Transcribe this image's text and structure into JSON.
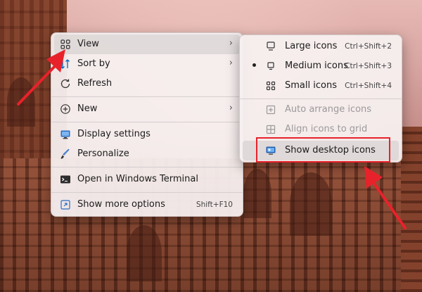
{
  "context_menu": {
    "items": [
      {
        "label": "View",
        "icon": "grid-icon",
        "has_submenu": true
      },
      {
        "label": "Sort by",
        "icon": "sort-icon",
        "has_submenu": true
      },
      {
        "label": "Refresh",
        "icon": "refresh-icon"
      },
      {
        "label": "New",
        "icon": "plus-circle-icon",
        "has_submenu": true
      },
      {
        "label": "Display settings",
        "icon": "display-icon"
      },
      {
        "label": "Personalize",
        "icon": "brush-icon"
      },
      {
        "label": "Open in Windows Terminal",
        "icon": "terminal-icon"
      },
      {
        "label": "Show more options",
        "icon": "more-options-icon",
        "shortcut": "Shift+F10"
      }
    ]
  },
  "view_submenu": {
    "items": [
      {
        "label": "Large icons",
        "shortcut": "Ctrl+Shift+2",
        "icon": "monitor-icon"
      },
      {
        "label": "Medium icons",
        "shortcut": "Ctrl+Shift+3",
        "icon": "monitor-small-icon",
        "selected": true
      },
      {
        "label": "Small icons",
        "shortcut": "Ctrl+Shift+4",
        "icon": "grid-icon"
      },
      {
        "label": "Auto arrange icons",
        "icon": "auto-arrange-icon",
        "disabled": true
      },
      {
        "label": "Align icons to grid",
        "icon": "align-grid-icon",
        "disabled": true
      },
      {
        "label": "Show desktop icons",
        "icon": "desktop-icon"
      }
    ]
  },
  "colors": {
    "annotation_red": "#e8222b",
    "accent_blue": "#0067c0"
  }
}
